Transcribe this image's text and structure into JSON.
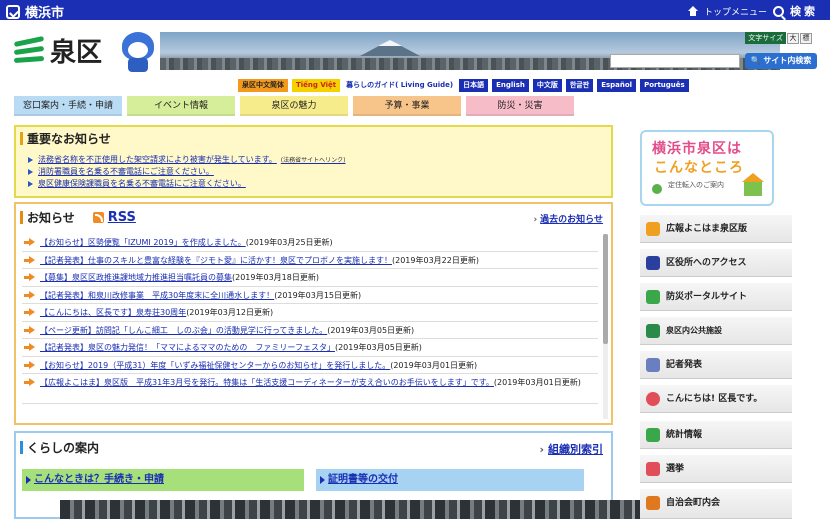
{
  "topbar": {
    "city_name": "横浜市",
    "top_menu": "トップメニュー",
    "search": "検索"
  },
  "header": {
    "ward_name": "泉区",
    "text_size_label": "文字サイズ",
    "text_size_large": "大",
    "text_size_standard": "標",
    "site_search_button": "サイト内検索",
    "site_search_value": ""
  },
  "languages": [
    {
      "label": "泉区中文简体",
      "style": "orange"
    },
    {
      "label": "Tiếng Việt",
      "style": "tieng"
    },
    {
      "label": "暮らしのガイド( Living Guide)",
      "style": "plain"
    },
    {
      "label": "日本語",
      "style": "blue"
    },
    {
      "label": "English",
      "style": "blue"
    },
    {
      "label": "中文版",
      "style": "blue"
    },
    {
      "label": "한글판",
      "style": "blue"
    },
    {
      "label": "Español",
      "style": "blue"
    },
    {
      "label": "Português",
      "style": "blue"
    }
  ],
  "nav_tabs": [
    {
      "label": "窓口案内・手続・申請",
      "color": "#b9dcf4"
    },
    {
      "label": "イベント情報",
      "color": "#d6ee9a"
    },
    {
      "label": "泉区の魅力",
      "color": "#f6ec8c"
    },
    {
      "label": "予算・事業",
      "color": "#f7c48a"
    },
    {
      "label": "防災・災害",
      "color": "#f6bcc8"
    }
  ],
  "important": {
    "title": "重要なお知らせ",
    "items": [
      {
        "text": "法務省名称を不正使用した架空請求により被害が発生しています。",
        "note": "(法務省サイトへリンク)"
      },
      {
        "text": "消防署職員を名乗る不審電話にご注意ください。",
        "note": ""
      },
      {
        "text": "泉区健康保険課職員を名乗る不審電話にご注意ください。",
        "note": ""
      }
    ]
  },
  "news": {
    "title": "お知らせ",
    "rss_label": "RSS",
    "past_link": "過去のお知らせ",
    "items": [
      {
        "link": "【お知らせ】区勢便覧「IZUMI 2019」を作成しました。",
        "date": "(2019年03月25日更新)"
      },
      {
        "link": "【記者発表】仕事のスキルと豊富な経験を『ジモト愛』に活かす！泉区でプロボノを実施します！",
        "date": "(2019年03月22日更新)"
      },
      {
        "link": "【募集】泉区区政推進課地域力推進担当嘱託員の募集",
        "date": "(2019年03月18日更新)"
      },
      {
        "link": "【記者発表】和泉川改修事業　平成30年度末に全川通水します！",
        "date": "(2019年03月15日更新)"
      },
      {
        "link": "【こんにちは、区長です】泉寿荘30周年",
        "date": "(2019年03月12日更新)"
      },
      {
        "link": "【ページ更新】訪問記「しんこ細工　しのぶ会」の活動見学に行ってきました。",
        "date": "(2019年03月05日更新)"
      },
      {
        "link": "【記者発表】泉区の魅力発信！「ママによるママのための　ファミリーフェスタ」",
        "date": "(2019年03月05日更新)"
      },
      {
        "link": "【お知らせ】2019（平成31）年度「いずみ福祉保健センターからのお知らせ」を発行しました。",
        "date": "(2019年03月01日更新)"
      },
      {
        "link": "【広報よこはま】泉区版　平成31年3月号を発行。特集は「生活支援コーディネーターが支え合いのお手伝いをします」です。",
        "date": "(2019年03月01日更新)"
      }
    ]
  },
  "kurashi": {
    "title": "くらしの案内",
    "org_link": "組織別索引",
    "button_left": "こんなときは？手続き・申請",
    "button_right": "証明書等の交付"
  },
  "sidebar": {
    "banner_line1": "横浜市泉区は",
    "banner_line2": "こんなところ",
    "banner_line3": "定住転入のご案内",
    "items": [
      {
        "label": "広報よこはま泉区版",
        "icon": "pencil-icon",
        "color": "#f0a020"
      },
      {
        "label": "区役所へのアクセス",
        "icon": "train-icon",
        "color": "#2b3f9e"
      },
      {
        "label": "防災ポータルサイト",
        "icon": "megaphone-icon",
        "color": "#3aa84a"
      },
      {
        "label": "泉区内公共施設",
        "icon": "building-icon",
        "color": "#2b8a4a"
      },
      {
        "label": "記者発表",
        "icon": "document-icon",
        "color": "#6a7fc0"
      },
      {
        "label": "こんにちは! 区長です。",
        "icon": "mascot-icon",
        "color": "#e24d5a"
      },
      {
        "label": "統計情報",
        "icon": "bar-chart-icon",
        "color": "#3aa84a"
      },
      {
        "label": "選挙",
        "icon": "ballot-icon",
        "color": "#e24d5a"
      },
      {
        "label": "自治会町内会",
        "icon": "community-icon",
        "color": "#e07820"
      }
    ]
  }
}
